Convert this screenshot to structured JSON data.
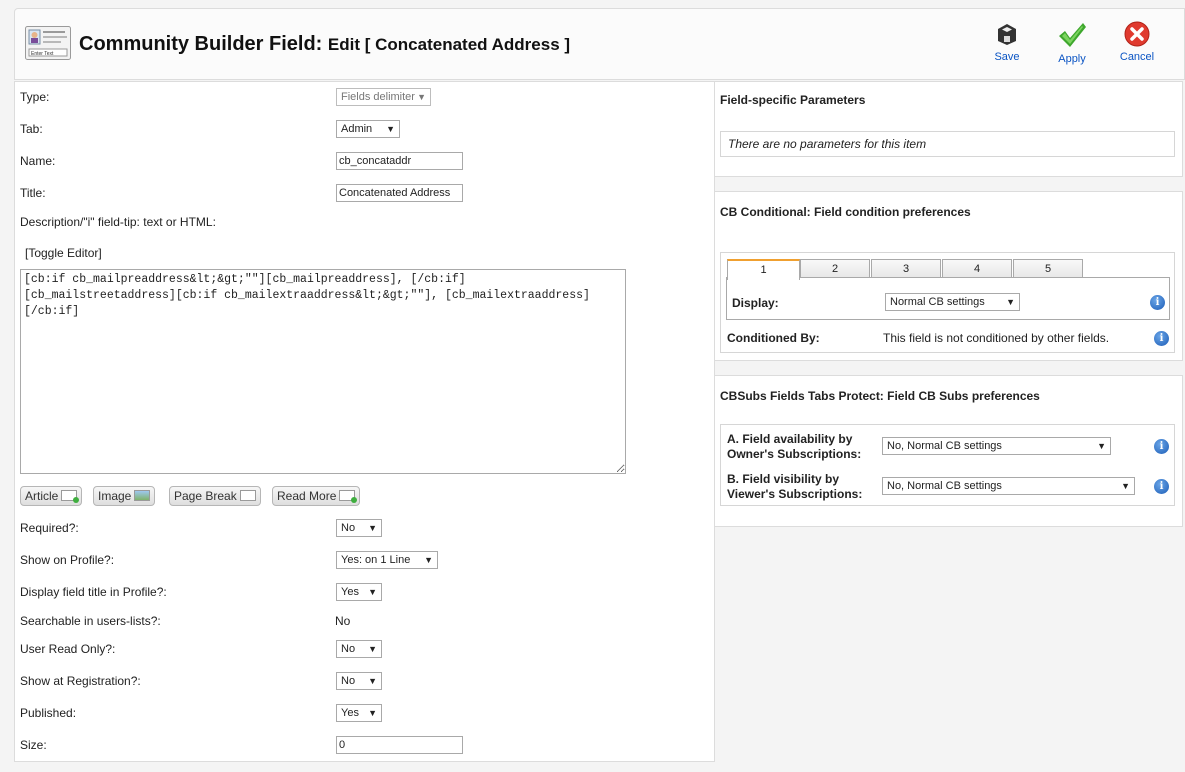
{
  "header": {
    "title": "Community Builder Field:",
    "subtitle": "Edit [ Concatenated Address ]",
    "icon": "field-card-icon",
    "icon_caption": "Enter Text"
  },
  "toolbar": {
    "save_label": "Save",
    "apply_label": "Apply",
    "cancel_label": "Cancel",
    "save_icon": "floppy-disk-icon",
    "apply_icon": "checkmark-icon",
    "cancel_icon": "cancel-x-icon",
    "link_color": "#0b55c4"
  },
  "form": {
    "type_label": "Type:",
    "type_value": "Fields delimiter",
    "tab_label": "Tab:",
    "tab_value": "Admin",
    "name_label": "Name:",
    "name_value": "cb_concataddr",
    "title_label": "Title:",
    "title_value": "Concatenated Address",
    "description_label": "Description/\"i\" field-tip: text or HTML:",
    "toggle_editor": "[Toggle Editor]",
    "description_value": "[cb:if cb_mailpreaddress&lt;&gt;\"\"][cb_mailpreaddress], [/cb:if]\n[cb_mailstreetaddress][cb:if cb_mailextraaddress&lt;&gt;\"\"], [cb_mailextraaddress]\n[/cb:if]",
    "editor_buttons": {
      "article": "Article",
      "image": "Image",
      "page_break": "Page Break",
      "read_more": "Read More"
    },
    "required_label": "Required?:",
    "required_value": "No",
    "show_profile_label": "Show on Profile?:",
    "show_profile_value": "Yes: on 1 Line",
    "display_title_label": "Display field title in Profile?:",
    "display_title_value": "Yes",
    "searchable_label": "Searchable in users-lists?:",
    "searchable_value": "No",
    "readonly_label": "User Read Only?:",
    "readonly_value": "No",
    "registration_label": "Show at Registration?:",
    "registration_value": "No",
    "published_label": "Published:",
    "published_value": "Yes",
    "size_label": "Size:",
    "size_value": "0"
  },
  "params": {
    "title": "Field-specific Parameters",
    "empty_text": "There are no parameters for this item"
  },
  "conditional": {
    "title": "CB Conditional: Field condition preferences",
    "tabs": [
      "1",
      "2",
      "3",
      "4",
      "5"
    ],
    "active_tab": "1",
    "display_label": "Display:",
    "display_value": "Normal CB settings",
    "conditioned_label": "Conditioned By:",
    "conditioned_value": "This field is not conditioned by other fields.",
    "active_tab_color": "#f0a030"
  },
  "cbsubs": {
    "title": "CBSubs Fields Tabs Protect: Field CB Subs preferences",
    "availability_label_1": "A. Field availability by",
    "availability_label_2": "Owner's Subscriptions:",
    "availability_value": "No, Normal CB settings",
    "visibility_label_1": "B. Field visibility by",
    "visibility_label_2": "Viewer's Subscriptions:",
    "visibility_value": "No, Normal CB settings"
  }
}
